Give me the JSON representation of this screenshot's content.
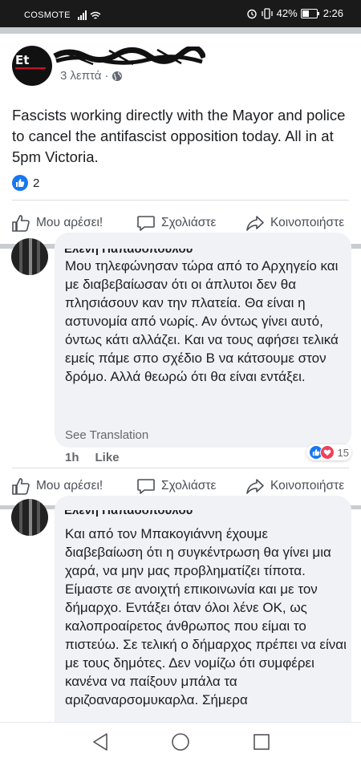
{
  "status_bar": {
    "carrier": "COSMOTE",
    "battery": "42%",
    "time": "2:26"
  },
  "post": {
    "author_badge": "Et",
    "time_ago": "3 λεπτά",
    "audience_icon": "globe-icon",
    "text": "Fascists working directly with the Mayor and police to cancel the antifascist opposition today. All in at 5pm Victoria.",
    "like_count": "2"
  },
  "actions": {
    "like": "Μου αρέσει!",
    "comment": "Σχολιάστε",
    "share": "Κοινοποιήστε"
  },
  "comments": [
    {
      "author_name": "Ελενη Παπαδοπουλου",
      "text": "Μου τηλεφώνησαν τώρα από το Αρχηγείο και με διαβεβαίωσαν ότι οι άπλυτοι δεν θα πλησιάσουν καν την πλατεία. Θα είναι η αστυνομία από νωρίς. Αν όντως γίνει αυτό, όντως κάτι αλλάζει. Και να τους αφήσει τελικά εμείς πάμε σπο σχέδιο Β να κάτσουμε στον δρόμο. Αλλά θεωρώ ότι θα είναι εντάξει.",
      "see_translation": "See Translation",
      "time": "1h",
      "like_label": "Like",
      "reaction_count": "15"
    },
    {
      "author_name": "Ελενη Παπαδοπουλου",
      "text": "Και από τον Μπακογιάννη έχουμε διαβεβαίωση ότι η συγκέντρωση θα γίνει μια χαρά, να μην μας προβληματίζει τίποτα. Είμαστε σε ανοιχτή επικοινωνία και με τον δήμαρχο. Εντάξει όταν όλοι λένε ΟΚ, ως καλοπροαίρετος άνθρωπος που είμαι το πιστεύω. Σε τελική ο δήμαρχος πρέπει να είναι με τους δημότες. Δεν νομίζω ότι συμφέρει κανένα να παίξουν μπάλα τα αριζοαναρσομυκαρλα. Σήμερα"
    }
  ],
  "nav": {
    "back_icon": "back-triangle-icon",
    "home_icon": "home-circle-icon",
    "recents_icon": "recents-square-icon"
  },
  "colors": {
    "facebook_blue": "#1877f2",
    "love_red": "#f33e58",
    "separator": "#c9ccd1",
    "bubble_bg": "#f0f2f5",
    "status_bar_bg": "#1a1a1a"
  }
}
